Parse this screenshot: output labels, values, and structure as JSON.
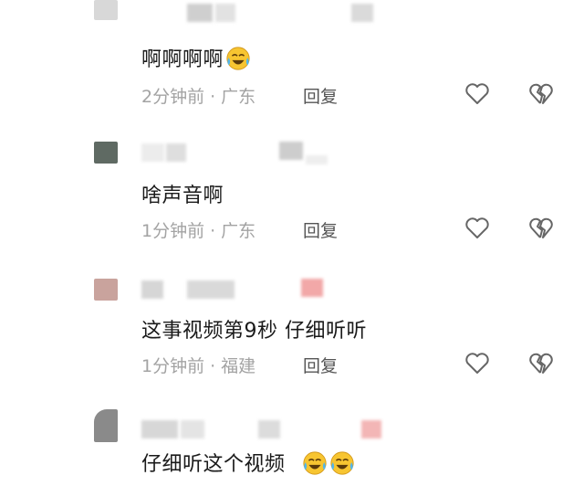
{
  "comments": [
    {
      "text": "啊啊啊啊",
      "emoji_count": 1,
      "time": "2分钟前",
      "location": "广东",
      "reply": "回复",
      "avatar_color": "#d8d8d8"
    },
    {
      "text": "啥声音啊",
      "emoji_count": 0,
      "time": "1分钟前",
      "location": "广东",
      "reply": "回复",
      "avatar_color": "#5f6a63"
    },
    {
      "text": "这事视频第9秒 仔细听听",
      "emoji_count": 0,
      "time": "1分钟前",
      "location": "福建",
      "reply": "回复",
      "avatar_color": "#c9a39d"
    },
    {
      "text": "仔细听这个视频",
      "emoji_count": 2,
      "time": "",
      "location": "",
      "reply": "",
      "avatar_color": "#8a8a8a"
    }
  ],
  "dot": "·",
  "icons": {
    "like": "heart-icon",
    "dislike": "broken-heart-icon",
    "emoji": "laughing-crying-emoji"
  },
  "colors": {
    "text": "#1a1a1a",
    "meta": "#a3a3a3",
    "icon": "#666666",
    "emoji_face": "#f7c531"
  }
}
